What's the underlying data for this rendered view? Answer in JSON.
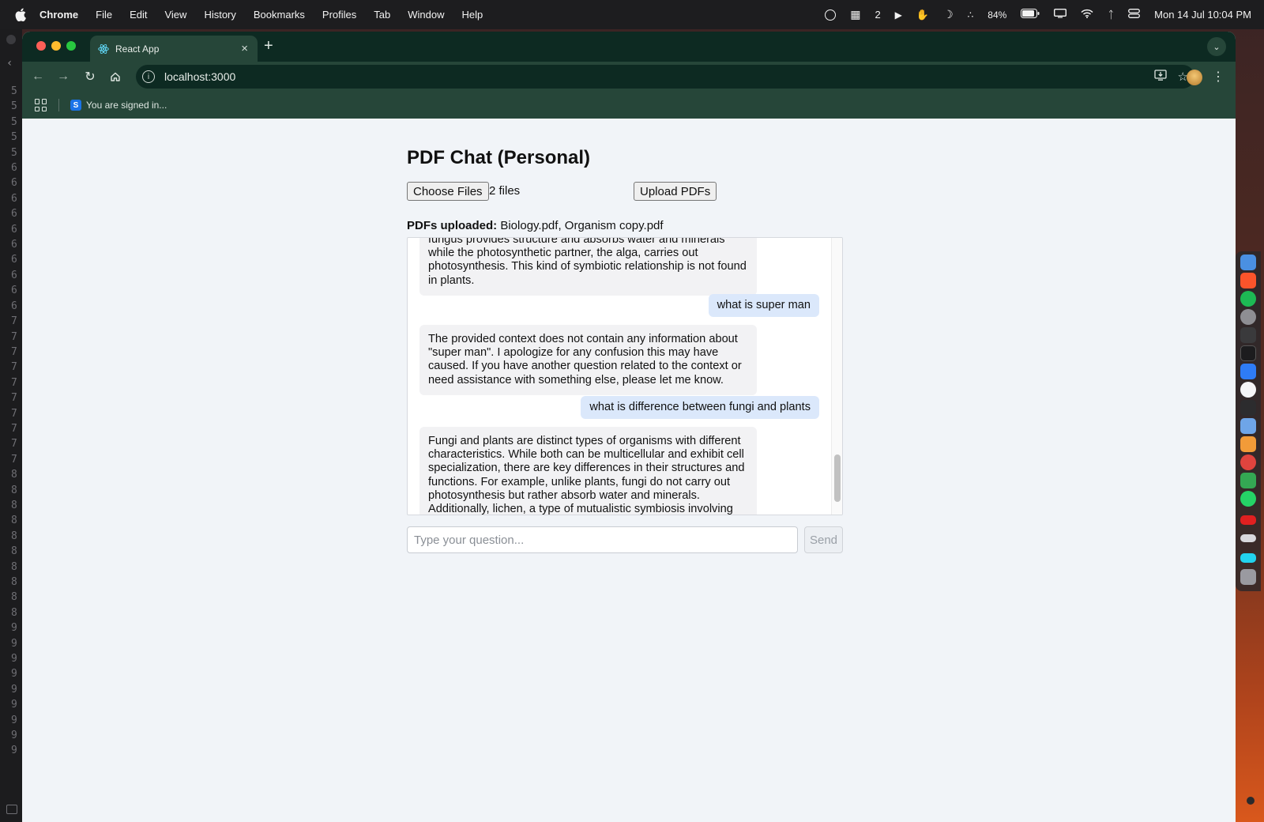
{
  "menubar": {
    "app_name": "Chrome",
    "items": [
      "File",
      "Edit",
      "View",
      "History",
      "Bookmarks",
      "Profiles",
      "Tab",
      "Window",
      "Help"
    ],
    "notification_count": "2",
    "battery": "84%",
    "clock": "Mon 14 Jul  10:04 PM"
  },
  "left_strip": {
    "line_numbers": [
      "5",
      "5",
      "5",
      "5",
      "5",
      "6",
      "6",
      "6",
      "6",
      "6",
      "6",
      "6",
      "6",
      "6",
      "6",
      "7",
      "7",
      "7",
      "7",
      "7",
      "7",
      "7",
      "7",
      "7",
      "7",
      "8",
      "8",
      "8",
      "8",
      "8",
      "8",
      "8",
      "8",
      "8",
      "8",
      "9",
      "9",
      "9",
      "9",
      "9",
      "9",
      "9",
      "9",
      "9"
    ]
  },
  "browser": {
    "tab_title": "React App",
    "new_tab_label": "+",
    "url": "localhost:3000",
    "bookmark_label": "You are signed in..."
  },
  "page": {
    "title": "PDF Chat (Personal)",
    "choose_files_label": "Choose Files",
    "files_selected": "2 files",
    "upload_label": "Upload PDFs",
    "uploaded_label": "PDFs uploaded:",
    "uploaded_files": "Biology.pdf, Organism copy.pdf"
  },
  "chat": {
    "messages": [
      {
        "role": "bot",
        "text": "fungus provides structure and absorbs water and minerals while the photosynthetic partner, the alga, carries out photosynthesis. This kind of symbiotic relationship is not found in plants."
      },
      {
        "role": "user",
        "text": "what is super man"
      },
      {
        "role": "bot",
        "text": "The provided context does not contain any information about \"super man\". I apologize for any confusion this may have caused. If you have another question related to the context or need assistance with something else, please let me know."
      },
      {
        "role": "user",
        "text": "what is difference between fungi and plants"
      },
      {
        "role": "bot",
        "text": "Fungi and plants are distinct types of organisms with different characteristics. While both can be multicellular and exhibit cell specialization, there are key differences in their structures and functions. For example, unlike plants, fungi do not carry out photosynthesis but rather absorb water and minerals. Additionally, lichen, a type of mutualistic symbiosis involving fungi, often occurs with photosynthetic partners, which"
      }
    ]
  },
  "input": {
    "placeholder": "Type your question...",
    "send_label": "Send"
  },
  "colors": {
    "browser_frame": "#264639",
    "tab_strip": "#0d2a22",
    "user_bubble": "#dbe8fb",
    "bot_bubble": "#f2f2f4",
    "page_bg": "#f1f4f8"
  }
}
